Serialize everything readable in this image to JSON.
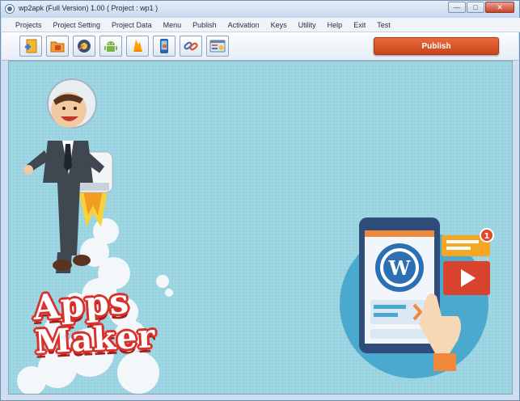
{
  "window": {
    "title": "wp2apk (Full Version) 1.00 ( Project : wp1 )",
    "controls": {
      "minimize": "—",
      "maximize": "□",
      "close": "✕"
    }
  },
  "menu": {
    "items": [
      "Projects",
      "Project Setting",
      "Project Data",
      "Menu",
      "Publish",
      "Activation",
      "Keys",
      "Utility",
      "Help",
      "Exit",
      "Test"
    ]
  },
  "toolbar": {
    "buttons": [
      "new-project-icon",
      "open-project-icon",
      "settings-icon",
      "android-icon",
      "firebase-icon",
      "mobile-preview-icon",
      "link-icon",
      "web-app-icon"
    ],
    "publish_label": "Publish"
  },
  "canvas": {
    "brand_line1": "Apps",
    "brand_line2": "Maker"
  },
  "colors": {
    "canvas_bg": "#9fd6e3",
    "publish_button": "#d9552a",
    "brand_outline": "#d9302a"
  }
}
